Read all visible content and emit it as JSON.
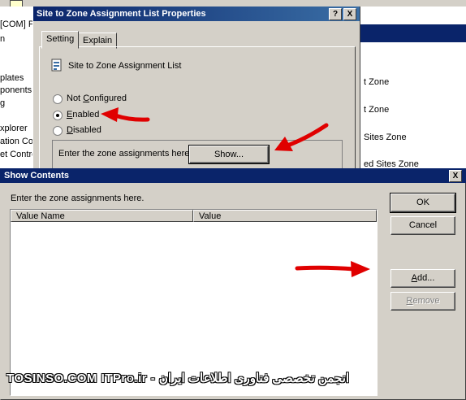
{
  "background": {
    "left_pane": [
      "[COM] Po",
      "n",
      "plates",
      "ponents",
      "g",
      "xplorer",
      "ation Com",
      "et Contro"
    ],
    "right_pane": [
      "t Zone",
      "t Zone",
      "Sites Zone",
      "ed Sites Zone"
    ]
  },
  "props_dialog": {
    "title": "Site to Zone Assignment List Properties",
    "help_btn": "?",
    "close_btn": "X",
    "tabs": [
      "Setting",
      "Explain"
    ],
    "policy_name": "Site to Zone Assignment List",
    "options": {
      "not_configured": "Not Configured",
      "enabled": "Enabled",
      "disabled": "Disabled",
      "selected": "Enabled"
    },
    "group_label": "Enter the zone assignments here.",
    "show_button": "Show..."
  },
  "show_dialog": {
    "title": "Show Contents",
    "close_btn": "X",
    "instruction": "Enter the zone assignments here.",
    "columns": [
      "Value Name",
      "Value"
    ],
    "buttons": {
      "ok": "OK",
      "cancel": "Cancel",
      "add": "Add...",
      "remove": "Remove"
    }
  },
  "watermark": "TOSINSO.COM ITPro.ir - انجمن تخصصی فناوری اطلاعات ایران",
  "colors": {
    "title_blue": "#0a246a",
    "annotation_red": "#e00000",
    "dialog_gray": "#d4d0c8"
  }
}
